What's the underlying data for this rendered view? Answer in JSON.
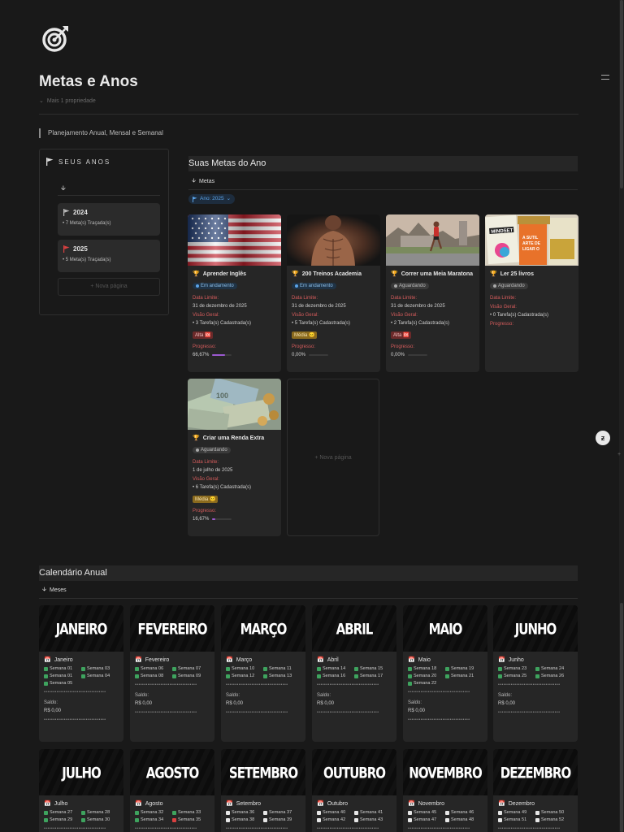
{
  "page": {
    "title": "Metas e Anos",
    "properties_toggle": "Mais 1 propriedade",
    "callout": "Planejamento Anual, Mensal e Semanal"
  },
  "years_panel": {
    "heading": "SEUS ANOS",
    "cards": [
      {
        "year": "2024",
        "subtitle": "• 7 Meta(s) Traçada(s)",
        "flag_color": "#b8b8b8"
      },
      {
        "year": "2025",
        "subtitle": "• 5 Meta(s) Traçada(s)",
        "flag_color": "#d94040"
      }
    ],
    "new_page": "+ Nova página"
  },
  "goals": {
    "heading": "Suas Metas do Ano",
    "view_tab": "Metas",
    "filter": "Ano: 2025",
    "field_labels": {
      "deadline": "Data Limite:",
      "overview": "Visão Geral:",
      "progress": "Progresso:"
    },
    "new_page": "+ Nova página",
    "cards": [
      {
        "name": "Aprender Inglês",
        "status": "Em andamento",
        "status_kind": "andamento",
        "deadline": "31 de dezembro de 2025",
        "tasks": "• 3 Tarefa(s) Cadastrada(s)",
        "priority": "Alta 🆘",
        "priority_kind": "alta",
        "progress_text": "66,67%",
        "progress": 0.6667
      },
      {
        "name": "200 Treinos Academia",
        "status": "Em andamento",
        "status_kind": "andamento",
        "deadline": "31 de dezembro de 2025",
        "tasks": "• 5 Tarefa(s) Cadastrada(s)",
        "priority": "Média 😐",
        "priority_kind": "media",
        "progress_text": "0,00%",
        "progress": 0
      },
      {
        "name": "Correr uma Meia Maratona",
        "status": "Aguardando",
        "status_kind": "aguardando",
        "deadline": "31 de dezembro de 2025",
        "tasks": "• 2 Tarefa(s) Cadastrada(s)",
        "priority": "Alta 🆘",
        "priority_kind": "alta",
        "progress_text": "0,00%",
        "progress": 0
      },
      {
        "name": "Ler 25 livros",
        "status": "Aguardando",
        "status_kind": "aguardando",
        "deadline": "",
        "tasks": "• 0 Tarefa(s) Cadastrada(s)",
        "priority": "",
        "priority_kind": "",
        "progress_text": "",
        "progress": null
      },
      {
        "name": "Criar uma Renda Extra",
        "status": "Aguardando",
        "status_kind": "aguardando",
        "deadline": "1 de julho de 2025",
        "tasks": "• 6 Tarefa(s) Cadastrada(s)",
        "priority": "Média 😐",
        "priority_kind": "media",
        "progress_text": "16,67%",
        "progress": 0.1667
      }
    ]
  },
  "calendar": {
    "heading": "Calendário Anual",
    "view_tab": "Meses",
    "saldo_label": "Saldo:",
    "dots": "••••••••••••••••••••••••••••••••••",
    "months": [
      {
        "banner": "JANEIRO",
        "name": "Janeiro",
        "weeks": [
          [
            "Semana 01",
            "on"
          ],
          [
            "Semana 03",
            "on"
          ],
          [
            "Semana 01",
            "on"
          ],
          [
            "Semana 04",
            "on"
          ],
          [
            "Semana 05",
            "on"
          ]
        ],
        "saldo": "R$ 0,00"
      },
      {
        "banner": "FEVEREIRO",
        "name": "Fevereiro",
        "weeks": [
          [
            "Semana 06",
            "on"
          ],
          [
            "Semana 07",
            "on"
          ],
          [
            "Semana 08",
            "on"
          ],
          [
            "Semana 09",
            "on"
          ]
        ],
        "saldo": "R$ 0,00"
      },
      {
        "banner": "MARÇO",
        "name": "Março",
        "weeks": [
          [
            "Semana 10",
            "on"
          ],
          [
            "Semana 11",
            "on"
          ],
          [
            "Semana 12",
            "on"
          ],
          [
            "Semana 13",
            "on"
          ]
        ],
        "saldo": "R$ 0,00"
      },
      {
        "banner": "ABRIL",
        "name": "Abril",
        "weeks": [
          [
            "Semana 14",
            "on"
          ],
          [
            "Semana 15",
            "on"
          ],
          [
            "Semana 16",
            "on"
          ],
          [
            "Semana 17",
            "on"
          ]
        ],
        "saldo": "R$ 0,00"
      },
      {
        "banner": "MAIO",
        "name": "Maio",
        "weeks": [
          [
            "Semana 18",
            "on"
          ],
          [
            "Semana 19",
            "on"
          ],
          [
            "Semana 20",
            "on"
          ],
          [
            "Semana 21",
            "on"
          ],
          [
            "Semana 22",
            "on"
          ]
        ],
        "saldo": "R$ 0,00"
      },
      {
        "banner": "JUNHO",
        "name": "Junho",
        "weeks": [
          [
            "Semana 23",
            "on"
          ],
          [
            "Semana 24",
            "on"
          ],
          [
            "Semana 25",
            "on"
          ],
          [
            "Semana 26",
            "on"
          ]
        ],
        "saldo": "R$ 0,00"
      },
      {
        "banner": "JULHO",
        "name": "Julho",
        "weeks": [
          [
            "Semana 27",
            "on"
          ],
          [
            "Semana 28",
            "on"
          ],
          [
            "Semana 29",
            "on"
          ],
          [
            "Semana 30",
            "on"
          ]
        ],
        "saldo": ""
      },
      {
        "banner": "AGOSTO",
        "name": "Agosto",
        "weeks": [
          [
            "Semana 32",
            "on"
          ],
          [
            "Semana 33",
            "on"
          ],
          [
            "Semana 34",
            "on"
          ],
          [
            "Semana 35",
            "red"
          ]
        ],
        "saldo": ""
      },
      {
        "banner": "SETEMBRO",
        "name": "Setembro",
        "weeks": [
          [
            "Semana 36",
            "off"
          ],
          [
            "Semana 37",
            "off"
          ],
          [
            "Semana 38",
            "off"
          ],
          [
            "Semana 39",
            "off"
          ]
        ],
        "saldo": ""
      },
      {
        "banner": "OUTUBRO",
        "name": "Outubro",
        "weeks": [
          [
            "Semana 40",
            "off"
          ],
          [
            "Semana 41",
            "off"
          ],
          [
            "Semana 42",
            "off"
          ],
          [
            "Semana 43",
            "off"
          ]
        ],
        "saldo": ""
      },
      {
        "banner": "NOVEMBRO",
        "name": "Novembro",
        "weeks": [
          [
            "Semana 45",
            "off"
          ],
          [
            "Semana 46",
            "off"
          ],
          [
            "Semana 47",
            "off"
          ],
          [
            "Semana 48",
            "off"
          ]
        ],
        "saldo": ""
      },
      {
        "banner": "DEZEMBRO",
        "name": "Dezembro",
        "weeks": [
          [
            "Semana 49",
            "off"
          ],
          [
            "Semana 50",
            "off"
          ],
          [
            "Semana 51",
            "off"
          ],
          [
            "Semana 52",
            "off"
          ]
        ],
        "saldo": ""
      }
    ]
  },
  "icons": {
    "logo": "target-arrow-icon",
    "flag": "flag-icon",
    "calendar": "calendar-icon",
    "trophy": "trophy-icon",
    "arrow": "arrow-down-icon"
  },
  "colors": {
    "background": "#191919",
    "card": "#262626",
    "accent_blue": "#5aa3e8",
    "label_red": "#d65c5c",
    "check_green": "#3ea35e",
    "progress_purple": "#9b59d0"
  }
}
